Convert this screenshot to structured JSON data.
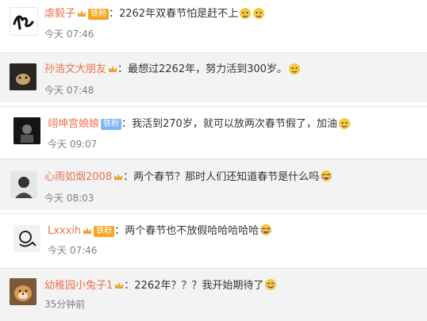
{
  "comments": [
    {
      "user": "虐毅子",
      "badge": "铁粉",
      "text": "：2262年双春节怕是赶不上",
      "time": "今天 07:46"
    },
    {
      "user": "孙浩文大朋友",
      "badge": "",
      "text": "：最想过2262年，努力活到300岁。",
      "time": "今天 07:48"
    },
    {
      "user": "翊坤宫娘娘",
      "badge": "铁粉",
      "text": "：我活到270岁，就可以放两次春节假了，加油",
      "time": "今天 09:07"
    },
    {
      "user": "心雨如烟2008",
      "badge": "",
      "text": "：两个春节？那时人们还知道春节是什么吗",
      "time": "今天 08:03"
    },
    {
      "user": "Lxxxih",
      "badge": "铁粉",
      "text": "：两个春节也不放假哈哈哈哈哈",
      "time": "今天 07:46"
    },
    {
      "user": "幼稚园小兔子1",
      "badge": "",
      "text": "：2262年？？？我开始期待了",
      "time": "35分钟前"
    }
  ],
  "colors": {
    "username": "#eb7350",
    "time": "#808080",
    "row_alt": "#f3f3f3",
    "badge_blue": "#7eb6ef",
    "badge_orange": "#f5a623"
  }
}
